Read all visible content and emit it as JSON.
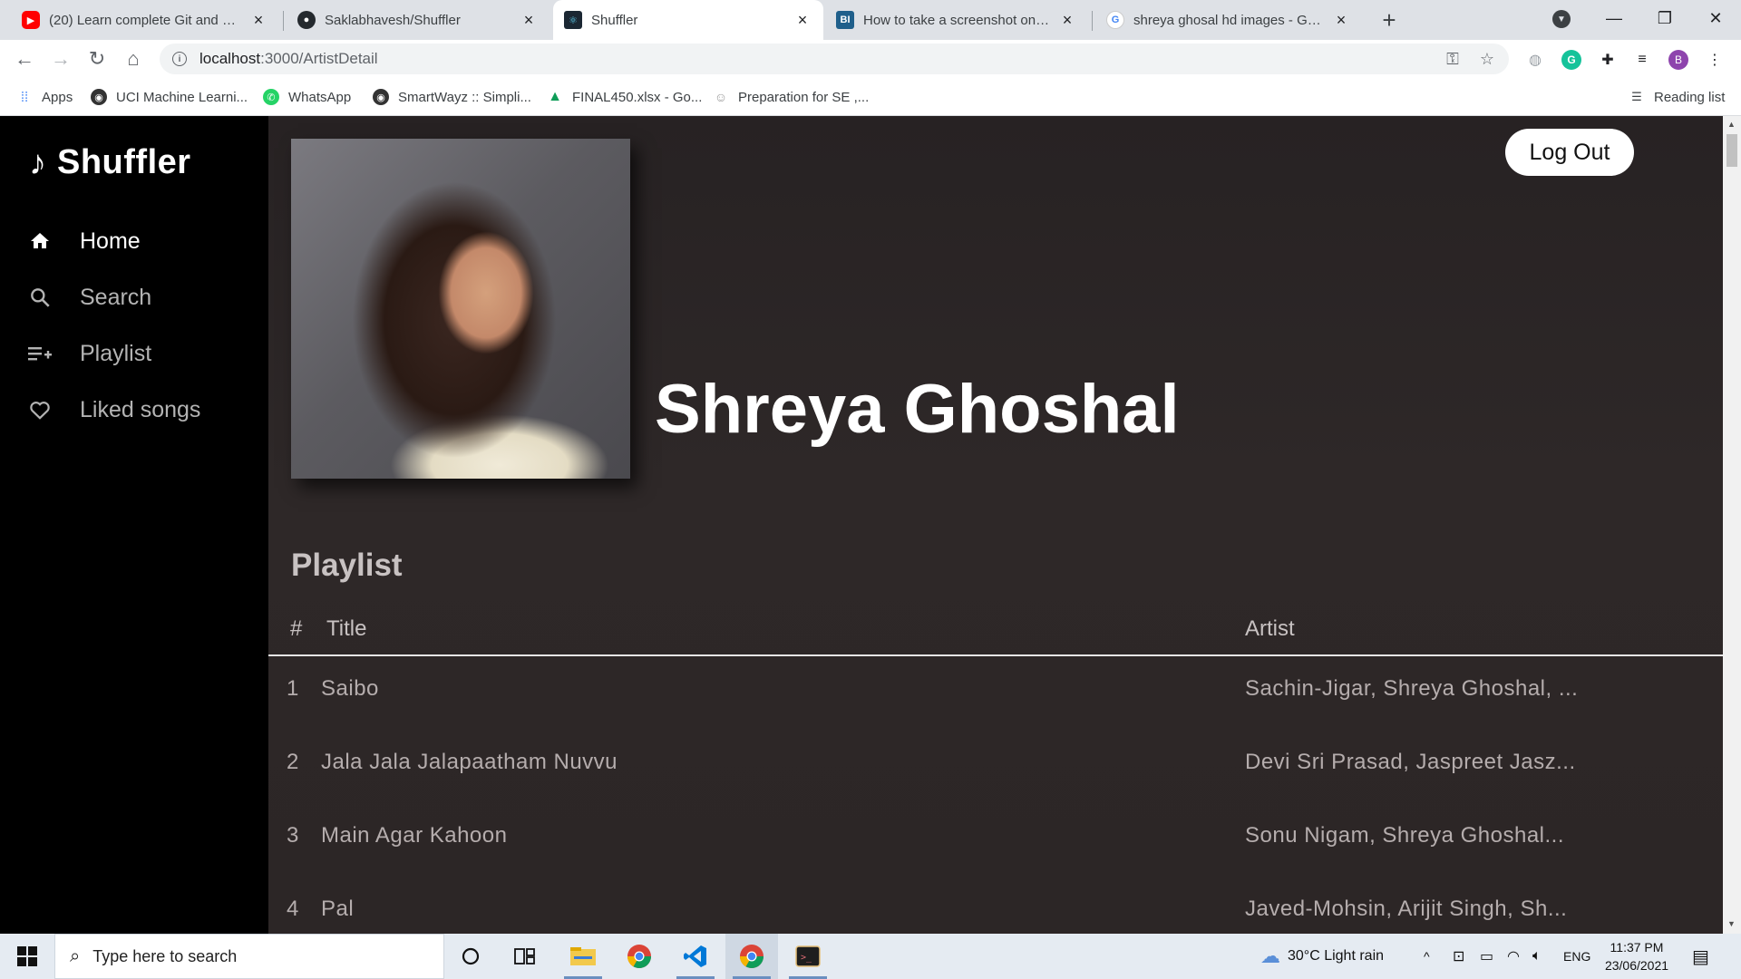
{
  "browser": {
    "tabs": [
      {
        "title": "(20) Learn complete Git and Github",
        "active": false
      },
      {
        "title": "Saklabhavesh/Shuffler",
        "active": false
      },
      {
        "title": "Shuffler",
        "active": true
      },
      {
        "title": "How to take a screenshot on any",
        "active": false
      },
      {
        "title": "shreya ghosal hd images - Google",
        "active": false
      }
    ],
    "url_host": "localhost",
    "url_path": ":3000/ArtistDetail",
    "profile_initial": "B",
    "bookmarks": [
      {
        "label": "Apps"
      },
      {
        "label": "UCI Machine Learni..."
      },
      {
        "label": "WhatsApp"
      },
      {
        "label": "SmartWayz :: Simpli..."
      },
      {
        "label": "FINAL450.xlsx - Go..."
      },
      {
        "label": "Preparation for SE ,..."
      }
    ],
    "reading_list": "Reading list"
  },
  "app": {
    "brand": "Shuffler",
    "nav": [
      {
        "label": "Home",
        "icon": "home-icon"
      },
      {
        "label": "Search",
        "icon": "search-icon"
      },
      {
        "label": "Playlist",
        "icon": "playlist-add-icon"
      },
      {
        "label": "Liked songs",
        "icon": "heart-icon"
      }
    ],
    "logout_label": "Log Out",
    "artist": {
      "name": "Shreya Ghoshal"
    },
    "playlist": {
      "title": "Playlist",
      "columns": {
        "num": "#",
        "title": "Title",
        "artist": "Artist"
      },
      "rows": [
        {
          "num": "1",
          "title": "Saibo",
          "artist": "Sachin-Jigar, Shreya Ghoshal, ..."
        },
        {
          "num": "2",
          "title": "Jala Jala Jalapaatham Nuvvu",
          "artist": "Devi Sri Prasad, Jaspreet Jasz..."
        },
        {
          "num": "3",
          "title": "Main Agar Kahoon",
          "artist": "Sonu Nigam, Shreya Ghoshal..."
        },
        {
          "num": "4",
          "title": "Pal",
          "artist": "Javed-Mohsin, Arijit Singh, Sh..."
        }
      ]
    }
  },
  "taskbar": {
    "search_placeholder": "Type here to search",
    "weather": "30°C  Light rain",
    "language": "ENG",
    "time": "11:37 PM",
    "date": "23/06/2021"
  }
}
